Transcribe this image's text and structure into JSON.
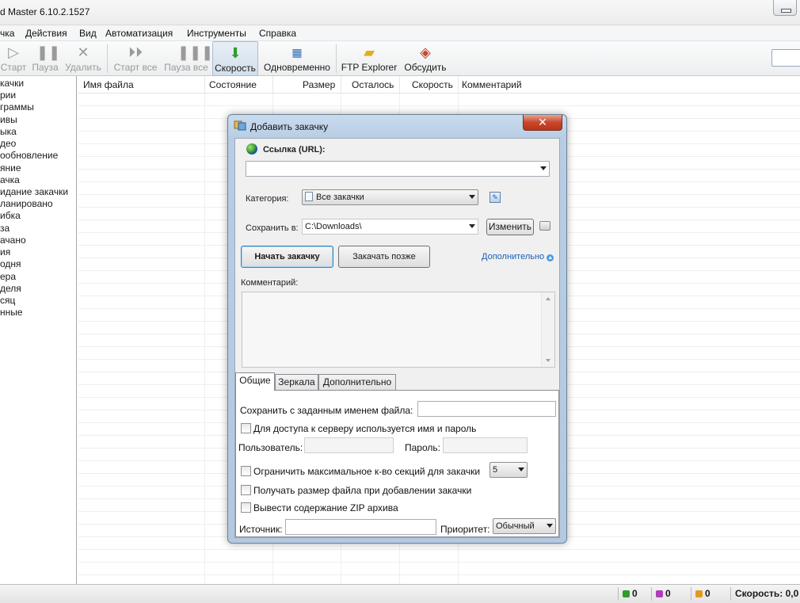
{
  "window": {
    "title": "d Master 6.10.2.1527"
  },
  "menu": [
    "чка",
    "Действия",
    "Вид",
    "Автоматизация",
    "Инструменты",
    "Справка"
  ],
  "toolbar": {
    "start": "Старт",
    "pause": "Пауза",
    "delete": "Удалить",
    "start_all": "Старт все",
    "pause_all": "Пауза все",
    "speed": "Скорость",
    "simultaneous": "Одновременно",
    "ftp": "FTP Explorer",
    "discuss": "Обсудить"
  },
  "sidebar": [
    "качки",
    "рии",
    "граммы",
    "ивы",
    "ыка",
    "део",
    "ообновление",
    "яние",
    "ачка",
    "идание закачки",
    "ланировано",
    "ибка",
    "за",
    "ачано",
    "ия",
    "одня",
    "ера",
    "деля",
    "сяц",
    "нные"
  ],
  "columns": [
    "Имя файла",
    "Состояние",
    "Размер",
    "Осталось",
    "Скорость",
    "Комментарий"
  ],
  "status": {
    "active": "0",
    "queued": "0",
    "paused": "0",
    "speed": "Скорость: 0,0",
    "colors": {
      "active": "#2e9c2e",
      "queued": "#b23bbd",
      "paused": "#e39a1c"
    }
  },
  "dialog": {
    "title": "Добавить закачку",
    "url_label": "Ссылка (URL):",
    "url_value": "",
    "category_label": "Категория:",
    "category_value": "Все закачки",
    "save_label": "Сохранить в:",
    "save_value": "C:\\Downloads\\",
    "change_btn": "Изменить",
    "start_btn": "Начать закачку",
    "later_btn": "Закачать позже",
    "more_link": "Дополнительно",
    "comment_label": "Комментарий:",
    "tabs": [
      "Общие",
      "Зеркала",
      "Дополнительно"
    ],
    "general": {
      "save_as_label": "Сохранить с заданным именем файла:",
      "auth_label": "Для доступа к серверу используется имя и пароль",
      "user_label": "Пользователь:",
      "password_label": "Пароль:",
      "limit_sections_label": "Ограничить максимальное к-во секций для закачки",
      "sections_value": "5",
      "get_size_label": "Получать размер файла при добавлении закачки",
      "zip_label": "Вывести содержание ZIP архива",
      "source_label": "Источник:",
      "priority_label": "Приоритет:",
      "priority_value": "Обычный"
    }
  }
}
